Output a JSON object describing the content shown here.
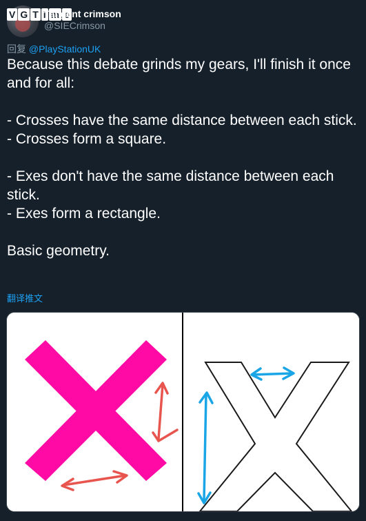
{
  "watermark": {
    "letters": [
      "V",
      "G",
      "T",
      "i",
      "m",
      "e"
    ]
  },
  "author": {
    "display_name": "Tangent crimson",
    "handle": "@SIECrimson"
  },
  "reply": {
    "prefix": "回复",
    "mention": "@PlayStationUK"
  },
  "tweet": {
    "text": "Because this debate grinds my gears, I'll finish it once and for all:\n\n- Crosses have the same distance between each stick.\n- Crosses form a square.\n\n- Exes don't have the same distance between each stick.\n- Exes form a rectangle.\n\nBasic geometry."
  },
  "translate": {
    "label": "翻译推文"
  },
  "media": {
    "colors": {
      "cross_fill": "#ff0aa5",
      "red_arrow": "#e8554e",
      "blue_arrow": "#1aa5e6",
      "divider": "#000000",
      "x_outline": "#1a1a1a"
    }
  }
}
